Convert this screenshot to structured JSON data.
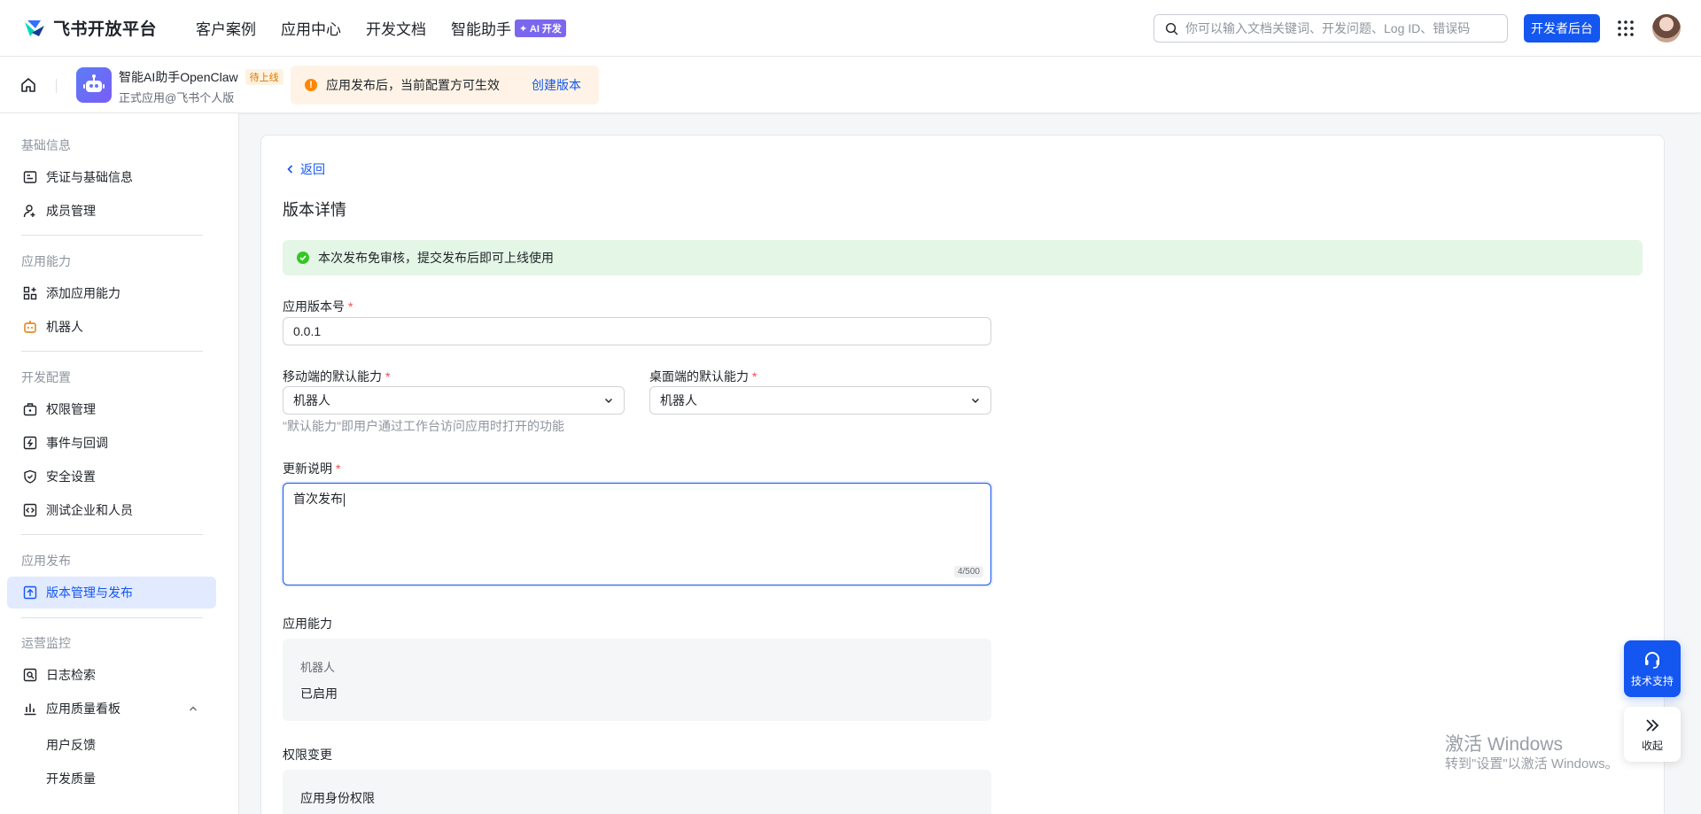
{
  "topnav": {
    "logo_text": "飞书开放平台",
    "links": [
      "客户案例",
      "应用中心",
      "开发文档",
      "智能助手"
    ],
    "ai_badge": "✦ AI 开发",
    "search_placeholder": "你可以输入文档关键词、开发问题、Log ID、错误码",
    "dev_console_label": "开发者后台"
  },
  "app": {
    "name": "智能AI助手OpenClaw",
    "status_badge": "待上线",
    "subtitle": "正式应用@飞书个人版"
  },
  "notice": {
    "text": "应用发布后，当前配置方可生效",
    "link": "创建版本"
  },
  "sidebar": {
    "sections": [
      {
        "title": "基础信息",
        "items": [
          "凭证与基础信息",
          "成员管理"
        ]
      },
      {
        "title": "应用能力",
        "items": [
          "添加应用能力",
          "机器人"
        ]
      },
      {
        "title": "开发配置",
        "items": [
          "权限管理",
          "事件与回调",
          "安全设置",
          "测试企业和人员"
        ]
      },
      {
        "title": "应用发布",
        "items": [
          "版本管理与发布"
        ]
      },
      {
        "title": "运营监控",
        "items": [
          "日志检索",
          "应用质量看板"
        ],
        "subitems": [
          "用户反馈",
          "开发质量"
        ]
      }
    ],
    "active_item": "版本管理与发布"
  },
  "main": {
    "back_label": "返回",
    "title": "版本详情",
    "success_text": "本次发布免审核，提交发布后即可上线使用",
    "version_label": "应用版本号",
    "version_value": "0.0.1",
    "mobile_label": "移动端的默认能力",
    "mobile_value": "机器人",
    "desktop_label": "桌面端的默认能力",
    "desktop_value": "机器人",
    "default_hint": "\"默认能力\"即用户通过工作台访问应用时打开的功能",
    "notes_label": "更新说明",
    "notes_value": "首次发布",
    "notes_counter": "4/500",
    "capability_label": "应用能力",
    "capability_name": "机器人",
    "capability_status": "已启用",
    "permission_label": "权限变更",
    "permission_item": "应用身份权限",
    "required_mark": "*"
  },
  "float": {
    "tech_support": "技术支持",
    "collapse": "收起"
  },
  "watermark": {
    "line1": "激活 Windows",
    "line2": "转到\"设置\"以激活 Windows。"
  },
  "colors": {
    "primary": "#1456f0",
    "success_bg": "#e4f6e6",
    "warning": "#ff8800",
    "required": "#f54a45"
  }
}
